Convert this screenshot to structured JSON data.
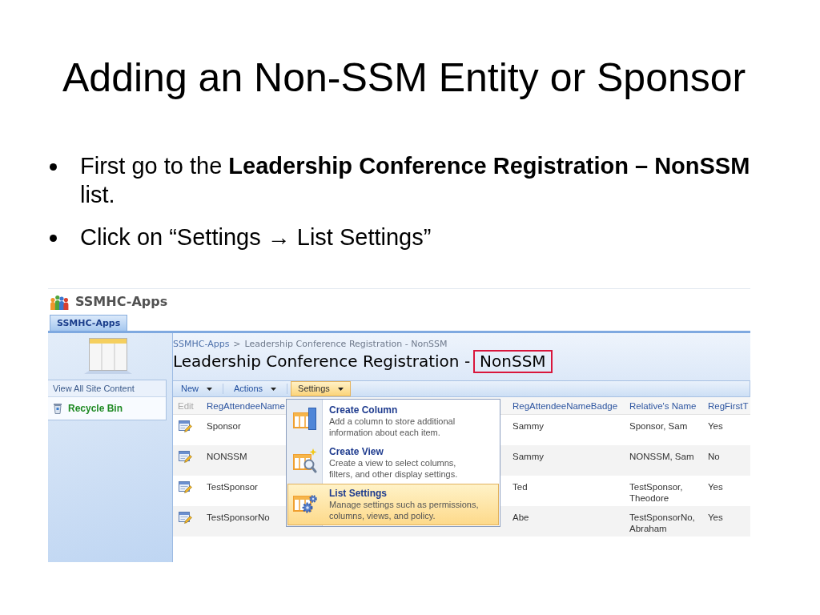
{
  "title": "Adding an Non-SSM Entity or Sponsor",
  "bullets": [
    "First go to the **Leadership Conference Registration – NonSSM** list.",
    "Click on “Settings → List Settings”"
  ],
  "screenshot": {
    "site_title": "SSMHC-Apps",
    "tabs": [
      {
        "label": "SSMHC-Apps",
        "selected": true
      }
    ],
    "quick_launch": [
      {
        "label": "View All Site Content",
        "kind": "link"
      },
      {
        "label": "Recycle Bin",
        "kind": "recycle_bin"
      }
    ],
    "breadcrumb": {
      "link": "SSMHC-Apps",
      "separator": ">",
      "current": "Leadership Conference Registration - NonSSM"
    },
    "list_title": {
      "text": "Leadership Conference Registration -",
      "callout": "NonSSM"
    },
    "toolbar": [
      {
        "label": "New",
        "highlighted": false
      },
      {
        "label": "Actions",
        "highlighted": false
      },
      {
        "label": "Settings",
        "highlighted": true
      }
    ],
    "table": {
      "edit_header": "Edit",
      "columns": [
        "RegAttendeeName",
        "RegAttendeeNameBadge",
        "Relative's Name",
        "RegFirstT"
      ],
      "rows": [
        {
          "cells": [
            "Sponsor",
            "Sammy",
            "Sponsor, Sam",
            "Yes"
          ]
        },
        {
          "cells": [
            "NONSSM",
            "Sammy",
            "NONSSM, Sam",
            "No"
          ]
        },
        {
          "cells": [
            "TestSponsor",
            "Ted",
            "TestSponsor, Theodore",
            "Yes"
          ]
        },
        {
          "cells": [
            "TestSponsorNo",
            "Abe",
            "TestSponsorNo, Abraham",
            "Yes"
          ]
        }
      ]
    },
    "settings_menu": {
      "items": [
        {
          "kind": "create_column",
          "title": "Create Column",
          "description": "Add a column to store additional information about each item.",
          "highlighted": false
        },
        {
          "kind": "create_view",
          "title": "Create View",
          "description": "Create a view to select columns, filters, and other display settings.",
          "highlighted": false
        },
        {
          "kind": "list_settings",
          "title": "List Settings",
          "description": "Manage settings such as permissions, columns, views, and policy.",
          "highlighted": true
        }
      ]
    }
  }
}
